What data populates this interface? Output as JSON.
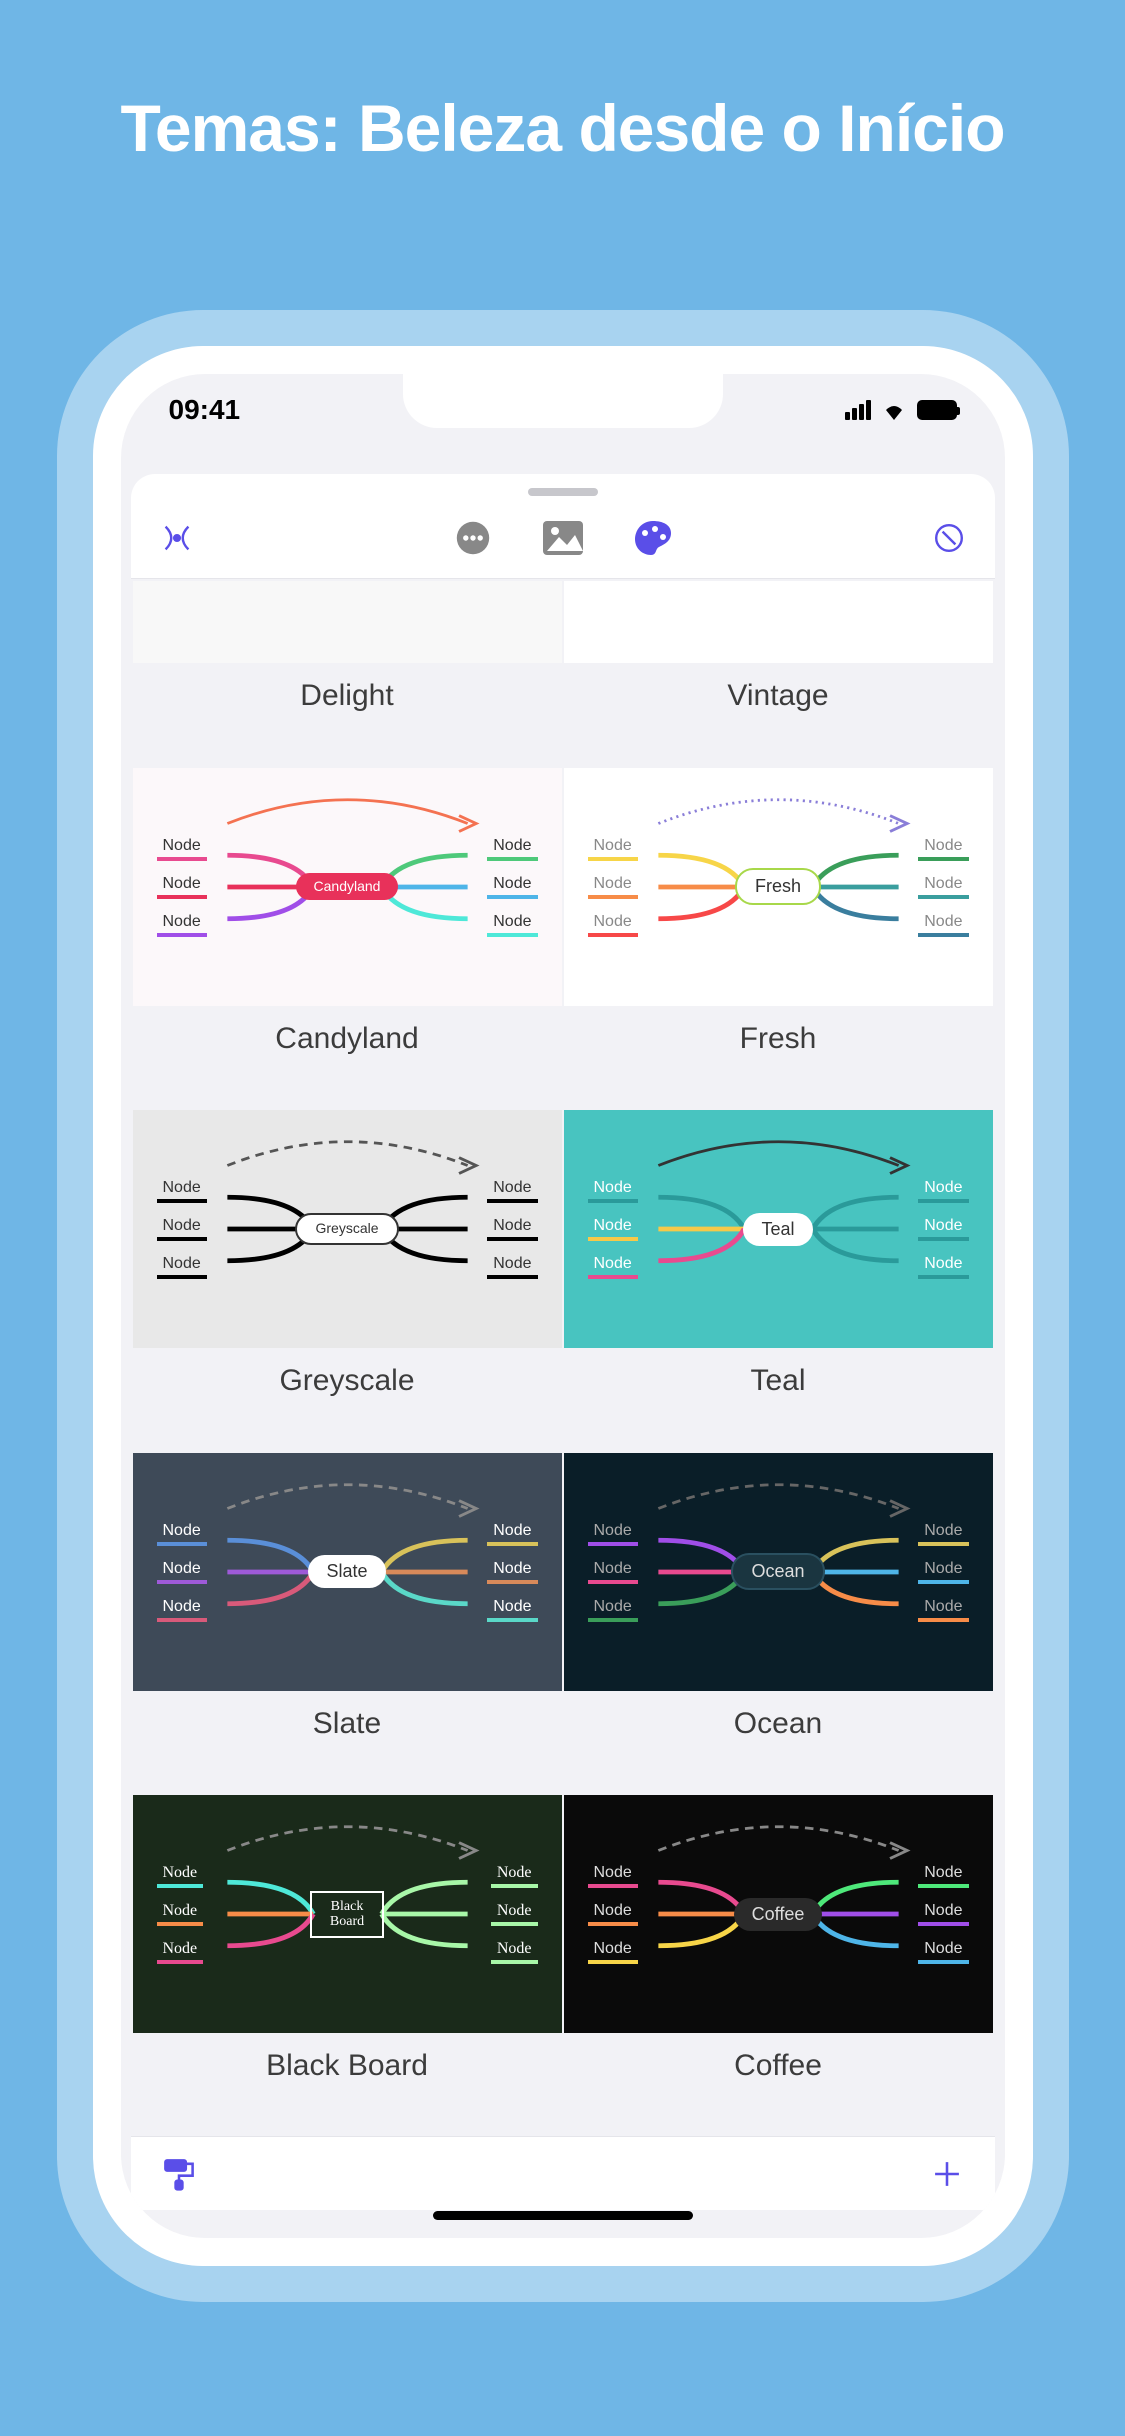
{
  "page_title": "Temas: Beleza desde o Início",
  "status": {
    "time": "09:41"
  },
  "node_label": "Node",
  "themes": [
    {
      "name": "Delight",
      "center": "",
      "bg": "#f8f8f8"
    },
    {
      "name": "Vintage",
      "center": "",
      "bg": "#ffffff"
    },
    {
      "name": "Candyland",
      "center": "Candyland",
      "bg": "#fcf8fa",
      "center_bg": "#e8315a",
      "center_color": "#fff",
      "left_colors": [
        "#e84a8f",
        "#e8315a",
        "#a04ee8"
      ],
      "right_colors": [
        "#4ec97a",
        "#4eb5e8",
        "#4ee8d8"
      ],
      "node_color": "#333",
      "arc_color": "#f47251",
      "arc_style": "solid"
    },
    {
      "name": "Fresh",
      "center": "Fresh",
      "bg": "#ffffff",
      "center_bg": "#fff",
      "center_color": "#333",
      "center_border": "#a8d84a",
      "left_colors": [
        "#f7d548",
        "#f78c48",
        "#f74848"
      ],
      "right_colors": [
        "#3a9e5a",
        "#3a9e9e",
        "#3a7e9e"
      ],
      "node_color": "#888",
      "arc_color": "#8a7ed8",
      "arc_style": "dotted"
    },
    {
      "name": "Greyscale",
      "center": "Greyscale",
      "bg": "#e8e8e8",
      "center_bg": "#fff",
      "center_color": "#333",
      "center_border": "#333",
      "left_colors": [
        "#000",
        "#000",
        "#000"
      ],
      "right_colors": [
        "#000",
        "#000",
        "#000"
      ],
      "node_color": "#333",
      "arc_color": "#555",
      "arc_style": "dashed"
    },
    {
      "name": "Teal",
      "center": "Teal",
      "bg": "#48c4c0",
      "center_bg": "#fff",
      "center_color": "#333",
      "left_colors": [
        "#2a9a9a",
        "#f7c948",
        "#e84a8f"
      ],
      "right_colors": [
        "#2a9a9a",
        "#2a9a9a",
        "#2a9a9a"
      ],
      "node_color": "#fff",
      "arc_color": "#333",
      "arc_style": "solid"
    },
    {
      "name": "Slate",
      "center": "Slate",
      "bg": "#3e4a58",
      "center_bg": "#fff",
      "center_color": "#333",
      "left_colors": [
        "#5a8fd8",
        "#9e5ad8",
        "#d85a7a"
      ],
      "right_colors": [
        "#d8c25a",
        "#d88a5a",
        "#5ad8c8"
      ],
      "node_color": "#fff",
      "arc_color": "#888",
      "arc_style": "dashed"
    },
    {
      "name": "Ocean",
      "center": "Ocean",
      "bg": "#0a1e28",
      "center_bg": "#1a3540",
      "center_color": "#ddd",
      "center_border": "#2a5060",
      "left_colors": [
        "#a04ee8",
        "#e84a8f",
        "#3a9e5a"
      ],
      "right_colors": [
        "#d8c25a",
        "#4eb5e8",
        "#f78c48"
      ],
      "node_color": "#aaa",
      "arc_color": "#666",
      "arc_style": "dashed"
    },
    {
      "name": "Black Board",
      "center": "Black Board",
      "bg": "#1a2a1a",
      "center_bg": "transparent",
      "center_color": "#fff",
      "center_border": "#fff",
      "center_square": true,
      "left_colors": [
        "#4ee8d8",
        "#f78c48",
        "#e84a8f"
      ],
      "right_colors": [
        "#a8f7a8",
        "#a8f7a8",
        "#a8f7a8"
      ],
      "node_color": "#fff",
      "font": "'Comic Sans MS', cursive",
      "arc_color": "#888",
      "arc_style": "dashed"
    },
    {
      "name": "Coffee",
      "center": "Coffee",
      "bg": "#0a0a0a",
      "center_bg": "#2a2a2a",
      "center_color": "#ddd",
      "left_colors": [
        "#e84a8f",
        "#f78c48",
        "#f7d548"
      ],
      "right_colors": [
        "#4ee87a",
        "#a04ee8",
        "#4eb5e8"
      ],
      "node_color": "#ddd",
      "arc_color": "#888",
      "arc_style": "dashed"
    }
  ]
}
